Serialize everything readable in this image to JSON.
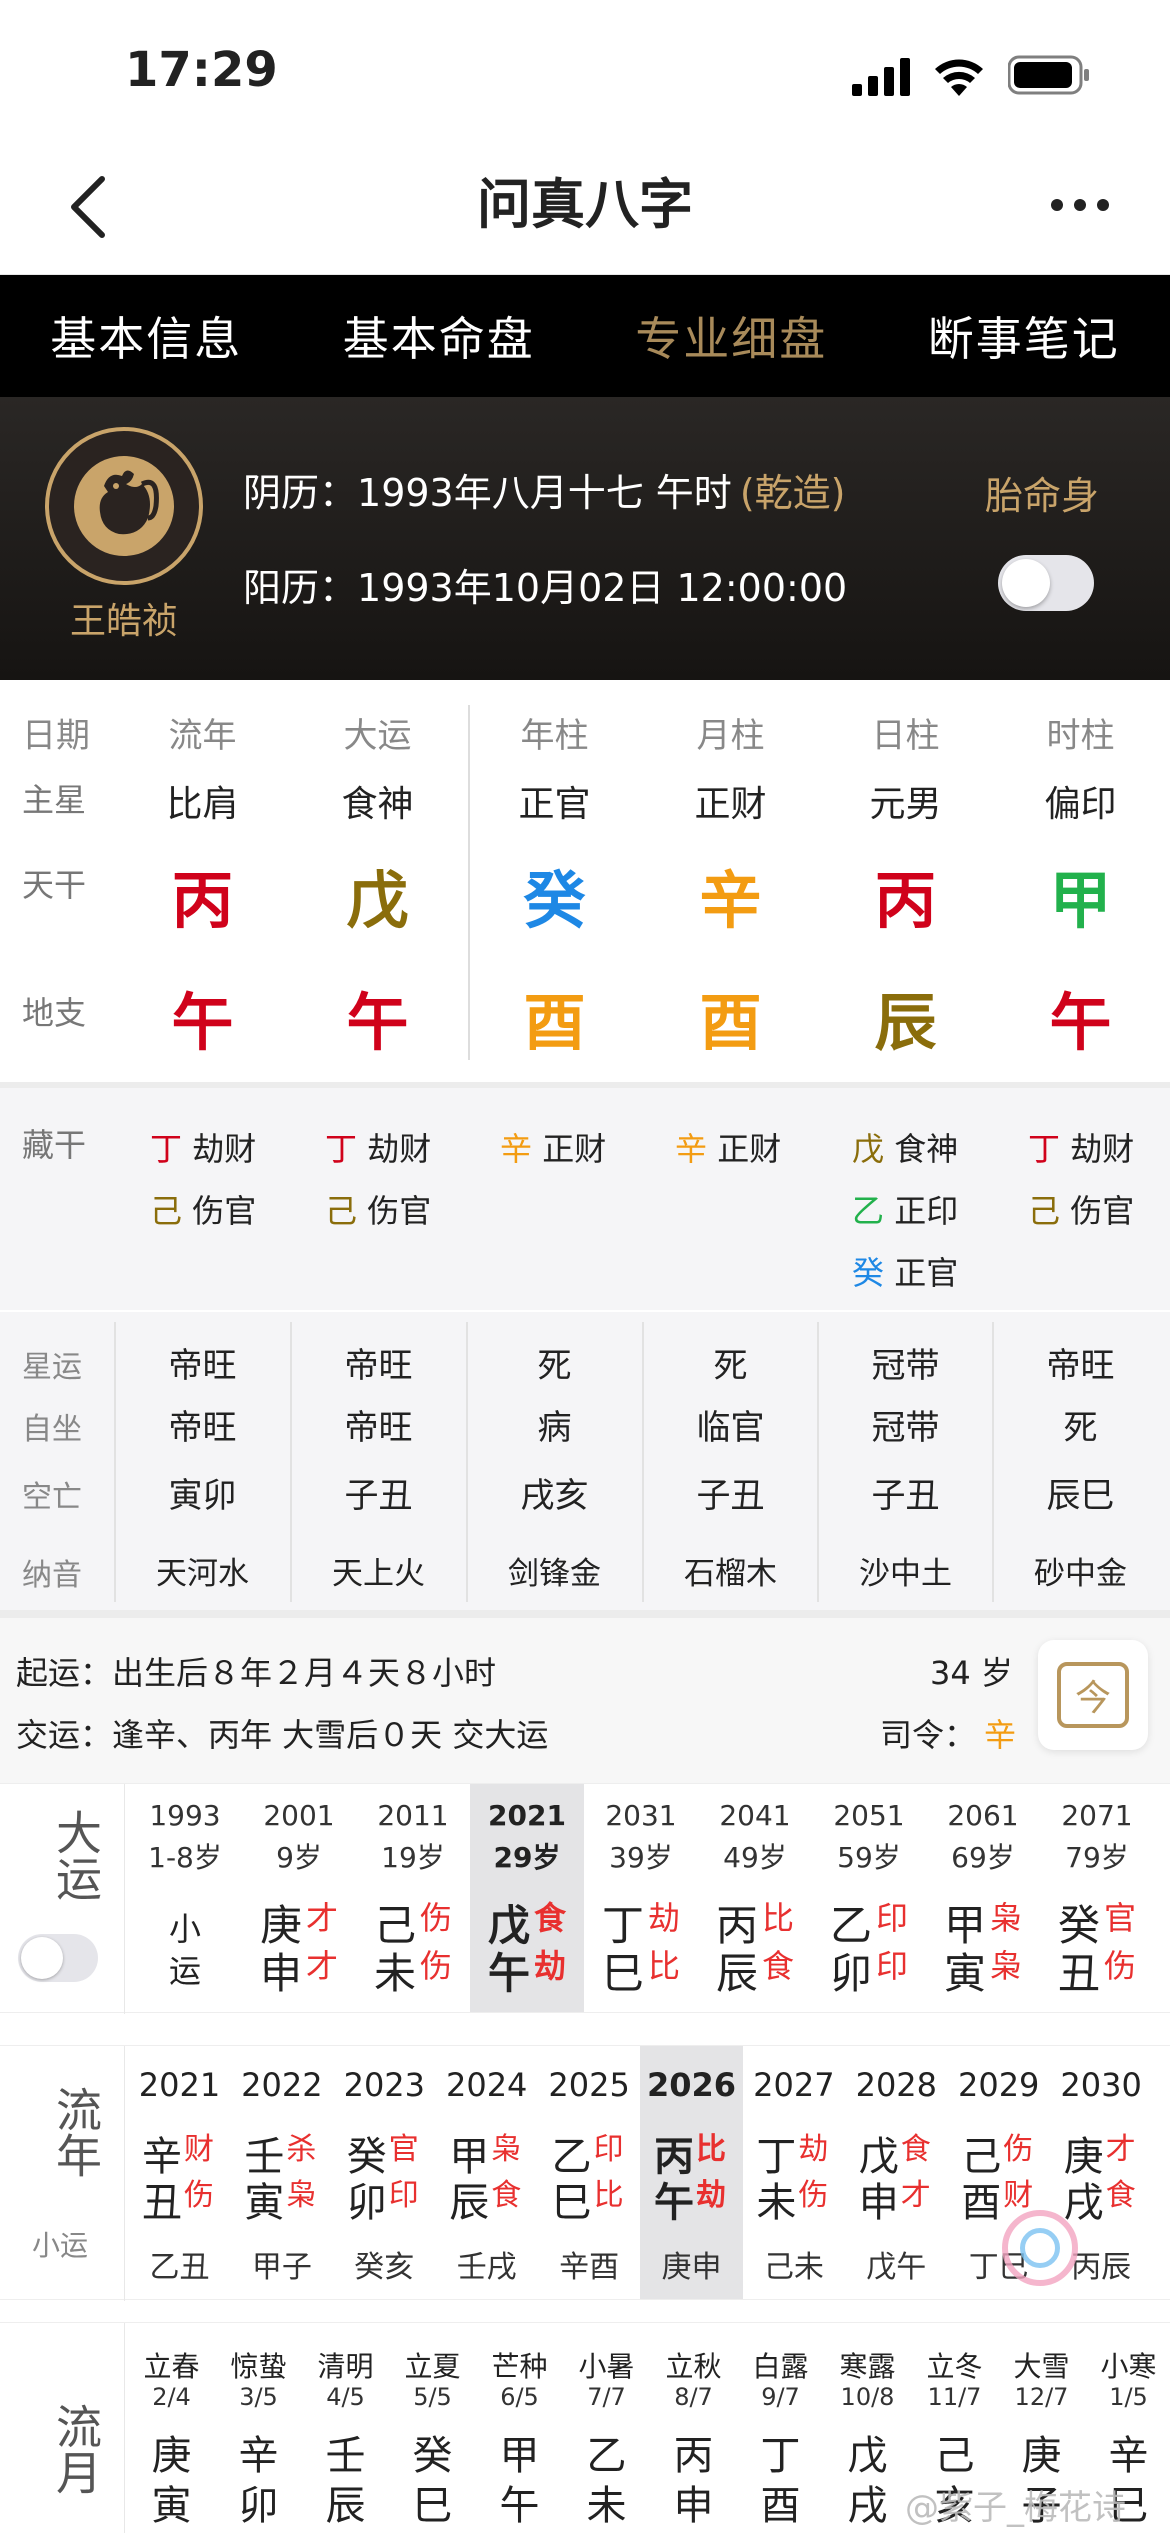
{
  "status": {
    "time": "17:29"
  },
  "title": "问真八字",
  "tabs": [
    "基本信息",
    "基本命盘",
    "专业细盘",
    "断事笔记"
  ],
  "profile": {
    "name": "王皓祯",
    "lunar_label": "阴历：",
    "lunar": "1993年八月十七  午时",
    "gender": "(乾造)",
    "solar_label": "阳历：",
    "solar": "1993年10月02日 12:00:00",
    "tai": "胎命身"
  },
  "pillars": {
    "row_labels": [
      "日期",
      "主星",
      "天干",
      "地支"
    ],
    "headers": [
      "流年",
      "大运",
      "年柱",
      "月柱",
      "日柱",
      "时柱"
    ],
    "stars": [
      "比肩",
      "食神",
      "正官",
      "正财",
      "元男",
      "偏印"
    ],
    "stems": [
      "丙",
      "戊",
      "癸",
      "辛",
      "丙",
      "甲"
    ],
    "branches": [
      "午",
      "午",
      "酉",
      "酉",
      "辰",
      "午"
    ]
  },
  "hidden": {
    "label": "藏干",
    "cols": [
      [
        [
          "丁",
          "劫财"
        ],
        [
          "己",
          "伤官"
        ]
      ],
      [
        [
          "丁",
          "劫财"
        ],
        [
          "己",
          "伤官"
        ]
      ],
      [
        [
          "辛",
          "正财"
        ]
      ],
      [
        [
          "辛",
          "正财"
        ]
      ],
      [
        [
          "戊",
          "食神"
        ],
        [
          "乙",
          "正印"
        ],
        [
          "癸",
          "正官"
        ]
      ],
      [
        [
          "丁",
          "劫财"
        ],
        [
          "己",
          "伤官"
        ]
      ]
    ]
  },
  "stats": {
    "labels": [
      "星运",
      "自坐",
      "空亡",
      "纳音"
    ],
    "cols": [
      [
        "帝旺",
        "帝旺",
        "寅卯",
        "天河水"
      ],
      [
        "帝旺",
        "帝旺",
        "子丑",
        "天上火"
      ],
      [
        "死",
        "病",
        "戌亥",
        "剑锋金"
      ],
      [
        "死",
        "临官",
        "子丑",
        "石榴木"
      ],
      [
        "冠带",
        "冠带",
        "子丑",
        "沙中土"
      ],
      [
        "帝旺",
        "死",
        "辰巳",
        "砂中金"
      ]
    ]
  },
  "qiyun": {
    "line1": "起运：出生后８年２月４天８小时",
    "line2": "交运：逢辛、丙年 大雪后０天 交大运",
    "age": "34 岁",
    "siling_label": "司令：",
    "siling": "辛",
    "today": "今"
  },
  "dayun": {
    "label": "大运",
    "items": [
      {
        "year": "1993",
        "age": "1-8岁",
        "g": "小",
        "z": "运",
        "gs": "",
        "zs": ""
      },
      {
        "year": "2001",
        "age": "9岁",
        "g": "庚",
        "z": "申",
        "gs": "才",
        "zs": "才"
      },
      {
        "year": "2011",
        "age": "19岁",
        "g": "己",
        "z": "未",
        "gs": "伤",
        "zs": "伤"
      },
      {
        "year": "2021",
        "age": "29岁",
        "g": "戊",
        "z": "午",
        "gs": "食",
        "zs": "劫"
      },
      {
        "year": "2031",
        "age": "39岁",
        "g": "丁",
        "z": "巳",
        "gs": "劫",
        "zs": "比"
      },
      {
        "year": "2041",
        "age": "49岁",
        "g": "丙",
        "z": "辰",
        "gs": "比",
        "zs": "食"
      },
      {
        "year": "2051",
        "age": "59岁",
        "g": "乙",
        "z": "卯",
        "gs": "印",
        "zs": "印"
      },
      {
        "year": "2061",
        "age": "69岁",
        "g": "甲",
        "z": "寅",
        "gs": "枭",
        "zs": "枭"
      },
      {
        "year": "2071",
        "age": "79岁",
        "g": "癸",
        "z": "丑",
        "gs": "官",
        "zs": "伤"
      }
    ]
  },
  "liunian": {
    "label": "流年",
    "sublabel": "小运",
    "items": [
      {
        "year": "2021",
        "g": "辛",
        "z": "丑",
        "gs": "财",
        "zs": "伤",
        "xy": "乙丑"
      },
      {
        "year": "2022",
        "g": "壬",
        "z": "寅",
        "gs": "杀",
        "zs": "枭",
        "xy": "甲子"
      },
      {
        "year": "2023",
        "g": "癸",
        "z": "卯",
        "gs": "官",
        "zs": "印",
        "xy": "癸亥"
      },
      {
        "year": "2024",
        "g": "甲",
        "z": "辰",
        "gs": "枭",
        "zs": "食",
        "xy": "壬戌"
      },
      {
        "year": "2025",
        "g": "乙",
        "z": "巳",
        "gs": "印",
        "zs": "比",
        "xy": "辛酉"
      },
      {
        "year": "2026",
        "g": "丙",
        "z": "午",
        "gs": "比",
        "zs": "劫",
        "xy": "庚申"
      },
      {
        "year": "2027",
        "g": "丁",
        "z": "未",
        "gs": "劫",
        "zs": "伤",
        "xy": "己未"
      },
      {
        "year": "2028",
        "g": "戊",
        "z": "申",
        "gs": "食",
        "zs": "才",
        "xy": "戊午"
      },
      {
        "year": "2029",
        "g": "己",
        "z": "酉",
        "gs": "伤",
        "zs": "财",
        "xy": "丁巳"
      },
      {
        "year": "2030",
        "g": "庚",
        "z": "戌",
        "gs": "才",
        "zs": "食",
        "xy": "丙辰"
      }
    ]
  },
  "liuyue": {
    "label": "流月",
    "items": [
      {
        "jq": "立春",
        "d": "2/4",
        "g": "庚",
        "z": "寅"
      },
      {
        "jq": "惊蛰",
        "d": "3/5",
        "g": "辛",
        "z": "卯"
      },
      {
        "jq": "清明",
        "d": "4/5",
        "g": "壬",
        "z": "辰"
      },
      {
        "jq": "立夏",
        "d": "5/5",
        "g": "癸",
        "z": "巳"
      },
      {
        "jq": "芒种",
        "d": "6/5",
        "g": "甲",
        "z": "午"
      },
      {
        "jq": "小暑",
        "d": "7/7",
        "g": "乙",
        "z": "未"
      },
      {
        "jq": "立秋",
        "d": "8/7",
        "g": "丙",
        "z": "申"
      },
      {
        "jq": "白露",
        "d": "9/7",
        "g": "丁",
        "z": "酉"
      },
      {
        "jq": "寒露",
        "d": "10/8",
        "g": "戊",
        "z": "戌"
      },
      {
        "jq": "立冬",
        "d": "11/7",
        "g": "己",
        "z": "亥"
      },
      {
        "jq": "大雪",
        "d": "12/7",
        "g": "庚",
        "z": "子"
      },
      {
        "jq": "小寒",
        "d": "1/5",
        "g": "辛",
        "z": "巳"
      }
    ]
  },
  "watermark": "@紫子_梅花诗",
  "colors": {
    "gold": "#a88a5a",
    "red": "#d0021b",
    "blue": "#1e88e5",
    "orange": "#f39c12",
    "green": "#22b14c",
    "olive": "#8a6d0b"
  }
}
